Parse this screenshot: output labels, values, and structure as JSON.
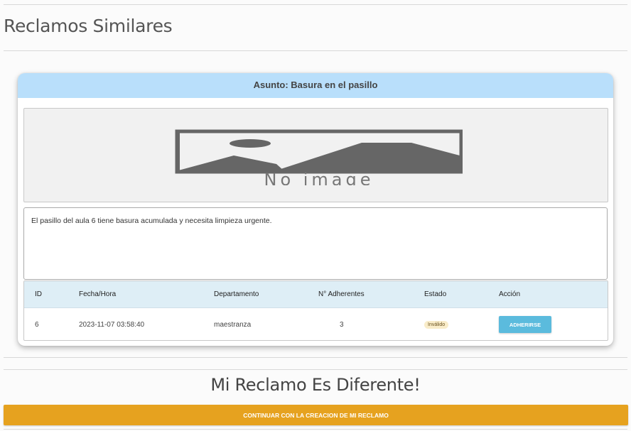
{
  "page": {
    "title": "Reclamos Similares"
  },
  "claim": {
    "subject": "Asunto: Basura en el pasillo",
    "image_placeholder": "No image",
    "description": "El pasillo del aula 6 tiene basura acumulada y necesita limpieza urgente."
  },
  "table": {
    "headers": {
      "id": "ID",
      "date": "Fecha/Hora",
      "department": "Departamento",
      "adherents": "N° Adherentes",
      "status": "Estado",
      "action": "Acción"
    },
    "row": {
      "id": "6",
      "date": "2023-11-07 03:58:40",
      "department": "maestranza",
      "adherents": "3",
      "status": "Inválido",
      "action_label": "ADHERIRSE"
    }
  },
  "footer": {
    "title": "Mi Reclamo Es Diferente!",
    "continue_label": "CONTINUAR CON LA CREACION DE MI RECLAMO"
  },
  "colors": {
    "header_bg": "#b9dffb",
    "table_header_bg": "#deeef6",
    "join_button": "#5bbbdd",
    "continue_button": "#e6a21f",
    "status_badge_bg": "#f9ecc9"
  }
}
